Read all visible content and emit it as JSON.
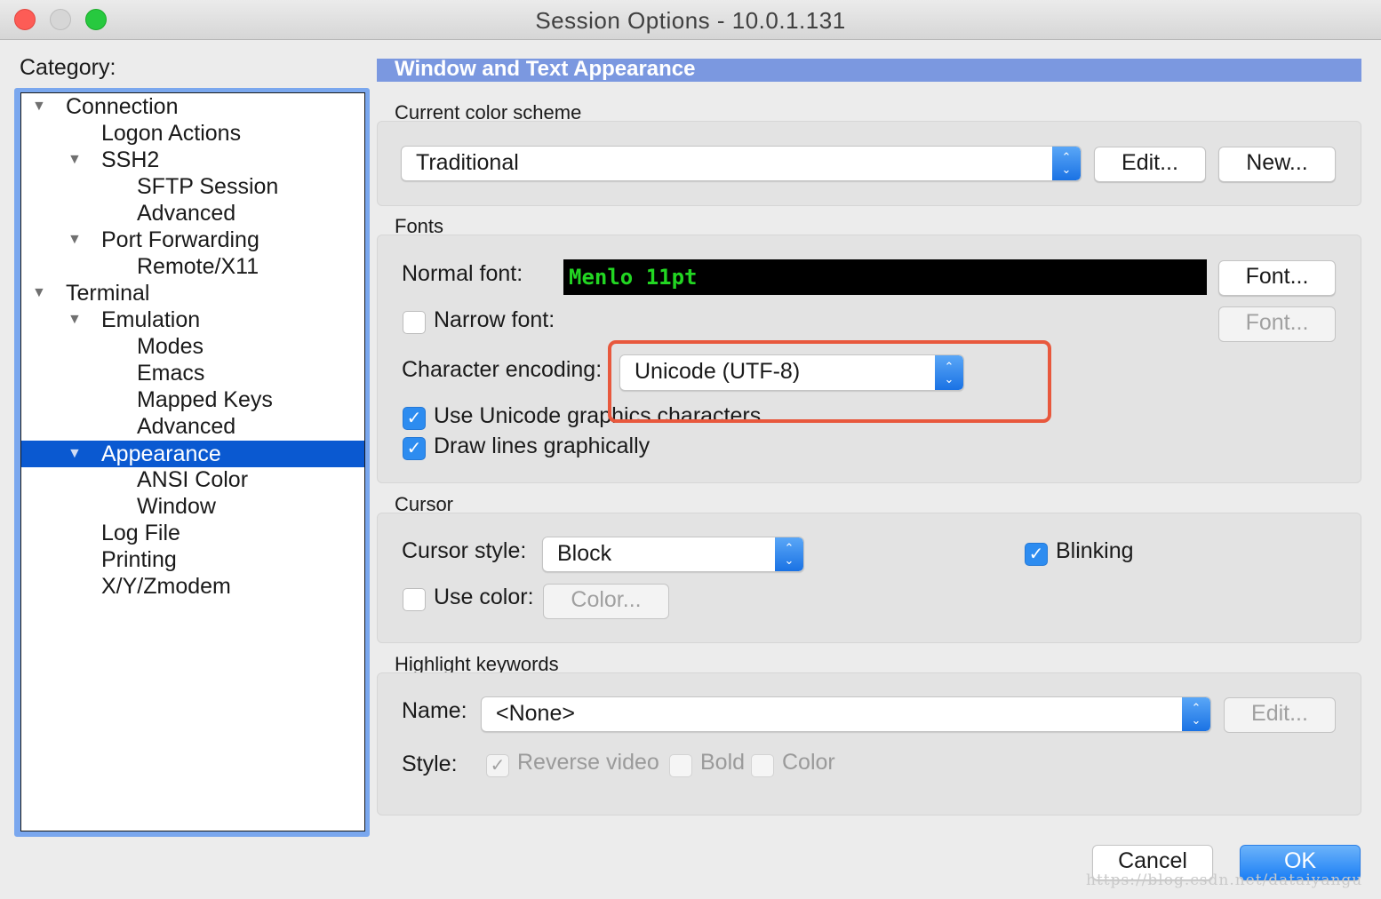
{
  "window": {
    "title": "Session Options - 10.0.1.131"
  },
  "category": {
    "label": "Category:",
    "items": [
      {
        "label": "Connection",
        "expanded": true
      },
      {
        "label": "Logon Actions"
      },
      {
        "label": "SSH2",
        "expanded": true
      },
      {
        "label": "SFTP Session"
      },
      {
        "label": "Advanced"
      },
      {
        "label": "Port Forwarding",
        "expanded": true
      },
      {
        "label": "Remote/X11"
      },
      {
        "label": "Terminal",
        "expanded": true
      },
      {
        "label": "Emulation",
        "expanded": true
      },
      {
        "label": "Modes"
      },
      {
        "label": "Emacs"
      },
      {
        "label": "Mapped Keys"
      },
      {
        "label": "Advanced"
      },
      {
        "label": "Appearance",
        "expanded": true,
        "selected": true
      },
      {
        "label": "ANSI Color"
      },
      {
        "label": "Window"
      },
      {
        "label": "Log File"
      },
      {
        "label": "Printing"
      },
      {
        "label": "X/Y/Zmodem"
      }
    ]
  },
  "panel": {
    "header": "Window and Text Appearance",
    "color_scheme": {
      "group_label": "Current color scheme",
      "selected": "Traditional",
      "edit_button": "Edit...",
      "new_button": "New..."
    },
    "fonts": {
      "group_label": "Fonts",
      "normal_font_label": "Normal font:",
      "normal_font_value": "Menlo 11pt",
      "font_button": "Font...",
      "narrow_font_label": "Narrow font:",
      "narrow_font_checked": false,
      "narrow_font_button": "Font...",
      "encoding_label": "Character encoding:",
      "encoding_value": "Unicode (UTF-8)",
      "unicode_graphics_label": "Use Unicode graphics characters",
      "unicode_graphics_checked": true,
      "draw_lines_label": "Draw lines graphically",
      "draw_lines_checked": true
    },
    "cursor": {
      "group_label": "Cursor",
      "style_label": "Cursor style:",
      "style_value": "Block",
      "blinking_label": "Blinking",
      "blinking_checked": true,
      "use_color_label": "Use color:",
      "use_color_checked": false,
      "color_button": "Color..."
    },
    "highlight": {
      "group_label": "Highlight keywords",
      "name_label": "Name:",
      "name_value": "<None>",
      "edit_button": "Edit...",
      "style_label": "Style:",
      "reverse_video_label": "Reverse video",
      "reverse_video_checked": true,
      "bold_label": "Bold",
      "bold_checked": false,
      "color_label": "Color",
      "color_checked": false
    }
  },
  "footer": {
    "cancel_button": "Cancel",
    "ok_button": "OK"
  },
  "watermark": "https://blog.csdn.net/dataiyangu",
  "colors": {
    "header_bar": "#7b98e0",
    "selection": "#0a59d1",
    "highlight_outline": "#e8583d",
    "font_preview_text": "#22d622"
  }
}
